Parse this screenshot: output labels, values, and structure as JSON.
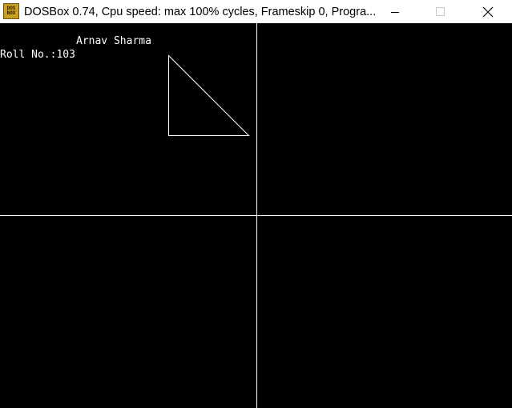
{
  "window": {
    "title": "DOSBox 0.74, Cpu speed: max 100% cycles, Frameskip  0, Progra...",
    "icon": "dosbox-icon",
    "icon_text_top": "DOS",
    "icon_text_bottom": "BOX",
    "controls": [
      "minimize",
      "maximize",
      "close"
    ]
  },
  "screen": {
    "background": "#000000",
    "foreground": "#ffffff",
    "name_text": "Arnav Sharma",
    "roll_text": "Roll No.:103"
  }
}
